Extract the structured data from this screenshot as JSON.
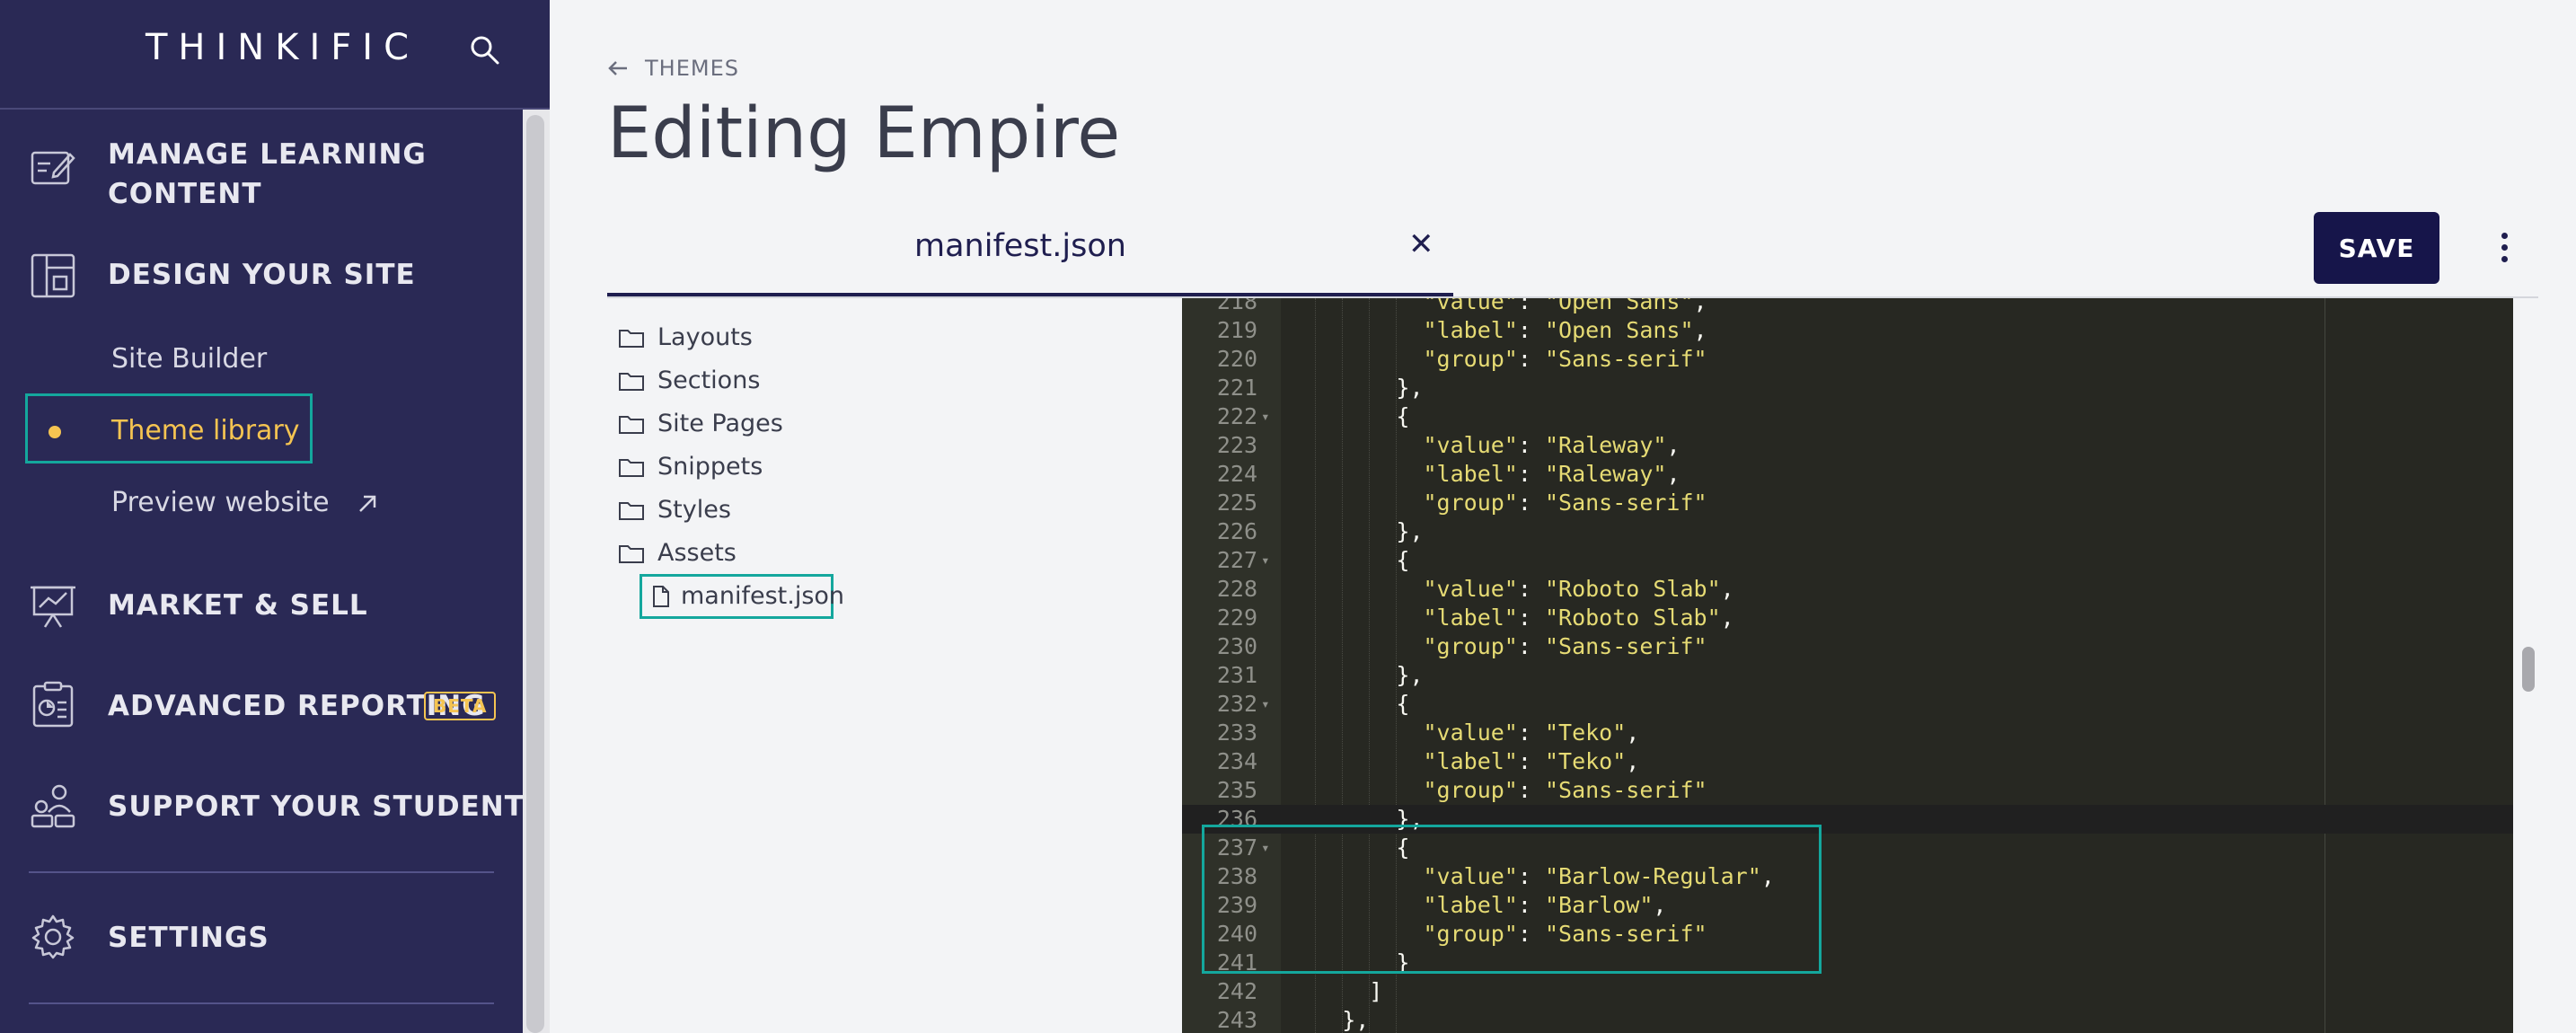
{
  "sidebar": {
    "logo": "THINKIFIC",
    "nav": {
      "manage_line1": "MANAGE LEARNING",
      "manage_line2": "CONTENT",
      "design": "DESIGN YOUR SITE",
      "site_builder": "Site Builder",
      "theme_library": "Theme library",
      "preview_website": "Preview website",
      "market": "MARKET & SELL",
      "reporting": "ADVANCED REPORTING",
      "reporting_badge": "BETA",
      "support": "SUPPORT YOUR STUDENTS",
      "settings": "SETTINGS"
    }
  },
  "header": {
    "breadcrumb": "THEMES",
    "title": "Editing Empire"
  },
  "tab": {
    "label": "manifest.json"
  },
  "toolbar": {
    "save_label": "SAVE"
  },
  "file_tree": {
    "folders": [
      "Layouts",
      "Sections",
      "Site Pages",
      "Snippets",
      "Styles",
      "Assets"
    ],
    "selected_file": "manifest.json"
  },
  "editor": {
    "lines": [
      {
        "n": "218",
        "indent": 5,
        "k": "\"value\"",
        "v": "\"Open Sans\"",
        "tail": ","
      },
      {
        "n": "219",
        "indent": 5,
        "k": "\"label\"",
        "v": "\"Open Sans\"",
        "tail": ","
      },
      {
        "n": "220",
        "indent": 5,
        "k": "\"group\"",
        "v": "\"Sans-serif\"",
        "tail": ""
      },
      {
        "n": "221",
        "indent": 4,
        "p": "},"
      },
      {
        "n": "222",
        "indent": 4,
        "p": "{",
        "fold": true
      },
      {
        "n": "223",
        "indent": 5,
        "k": "\"value\"",
        "v": "\"Raleway\"",
        "tail": ","
      },
      {
        "n": "224",
        "indent": 5,
        "k": "\"label\"",
        "v": "\"Raleway\"",
        "tail": ","
      },
      {
        "n": "225",
        "indent": 5,
        "k": "\"group\"",
        "v": "\"Sans-serif\"",
        "tail": ""
      },
      {
        "n": "226",
        "indent": 4,
        "p": "},"
      },
      {
        "n": "227",
        "indent": 4,
        "p": "{",
        "fold": true
      },
      {
        "n": "228",
        "indent": 5,
        "k": "\"value\"",
        "v": "\"Roboto Slab\"",
        "tail": ","
      },
      {
        "n": "229",
        "indent": 5,
        "k": "\"label\"",
        "v": "\"Roboto Slab\"",
        "tail": ","
      },
      {
        "n": "230",
        "indent": 5,
        "k": "\"group\"",
        "v": "\"Sans-serif\"",
        "tail": ""
      },
      {
        "n": "231",
        "indent": 4,
        "p": "},"
      },
      {
        "n": "232",
        "indent": 4,
        "p": "{",
        "fold": true
      },
      {
        "n": "233",
        "indent": 5,
        "k": "\"value\"",
        "v": "\"Teko\"",
        "tail": ","
      },
      {
        "n": "234",
        "indent": 5,
        "k": "\"label\"",
        "v": "\"Teko\"",
        "tail": ","
      },
      {
        "n": "235",
        "indent": 5,
        "k": "\"group\"",
        "v": "\"Sans-serif\"",
        "tail": ""
      },
      {
        "n": "236",
        "indent": 4,
        "p": "},",
        "hl": true
      },
      {
        "n": "237",
        "indent": 4,
        "p": "{",
        "fold": true
      },
      {
        "n": "238",
        "indent": 5,
        "k": "\"value\"",
        "v": "\"Barlow-Regular\"",
        "tail": ","
      },
      {
        "n": "239",
        "indent": 5,
        "k": "\"label\"",
        "v": "\"Barlow\"",
        "tail": ","
      },
      {
        "n": "240",
        "indent": 5,
        "k": "\"group\"",
        "v": "\"Sans-serif\"",
        "tail": ""
      },
      {
        "n": "241",
        "indent": 4,
        "p": "}"
      },
      {
        "n": "242",
        "indent": 3,
        "p": "]"
      },
      {
        "n": "243",
        "indent": 2,
        "p": "},"
      }
    ]
  },
  "colors": {
    "sidebar_bg": "#2a2955",
    "accent_teal": "#14a79d",
    "accent_yellow": "#f5c451",
    "editor_bg": "#272822",
    "string_color": "#e6db74",
    "brand_navy": "#16154a"
  }
}
